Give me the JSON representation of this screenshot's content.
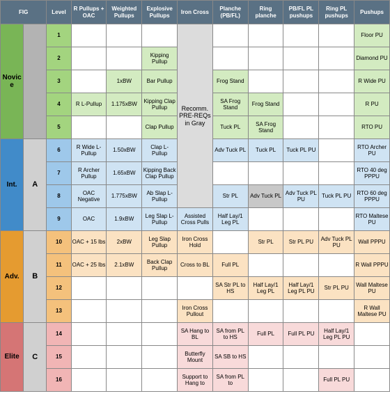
{
  "headers": {
    "fig": "FIG",
    "level": "Level",
    "skills": [
      "R Pullups + OAC",
      "Weighted Pullups",
      "Explosive Pullups",
      "Iron Cross",
      "Planche (PB/FL)",
      "Ring planche",
      "PB/FL PL pushups",
      "Ring PL pushups",
      "Pushups"
    ]
  },
  "tiers": [
    {
      "name": "Novice",
      "fig": "",
      "levels": [
        1,
        2,
        3,
        4,
        5
      ],
      "tierClass": "tier-novice-bg",
      "lvlClass": "lvl-green",
      "figClass": "fig-grey",
      "cellClass": "c-green"
    },
    {
      "name": "Int.",
      "fig": "A",
      "levels": [
        6,
        7,
        8,
        9
      ],
      "tierClass": "tier-int-bg",
      "lvlClass": "lvl-blue",
      "figClass": "fig-ltgrey",
      "cellClass": "c-blue"
    },
    {
      "name": "Adv.",
      "fig": "B",
      "levels": [
        10,
        11,
        12,
        13
      ],
      "tierClass": "tier-adv-bg",
      "lvlClass": "lvl-orange",
      "figClass": "fig-ltgrey",
      "cellClass": "c-orange"
    },
    {
      "name": "Elite",
      "fig": "C",
      "levels": [
        14,
        15,
        16
      ],
      "tierClass": "tier-elite-bg",
      "lvlClass": "lvl-red",
      "figClass": "fig-ltgrey",
      "cellClass": "c-red"
    }
  ],
  "iron_cross_recomm": "Recomm. PRE-REQs in Gray",
  "data": {
    "1": {
      "r_pullups": "",
      "weighted": "",
      "explosive": "",
      "iron_cross": null,
      "planche": "",
      "ring_pl": "",
      "pbfl_pu": "",
      "ringpl_pu": "",
      "pushups": "Floor PU"
    },
    "2": {
      "r_pullups": "",
      "weighted": "",
      "explosive": "Kipping Pullup",
      "iron_cross": null,
      "planche": "",
      "ring_pl": "",
      "pbfl_pu": "",
      "ringpl_pu": "",
      "pushups": "Diamond PU"
    },
    "3": {
      "r_pullups": "",
      "weighted": "1xBW",
      "explosive": "Bar Pullup",
      "iron_cross": null,
      "planche": "Frog Stand",
      "ring_pl": "",
      "pbfl_pu": "",
      "ringpl_pu": "",
      "pushups": "R Wide PU"
    },
    "4": {
      "r_pullups": "R L-Pullup",
      "weighted": "1.175xBW",
      "explosive": "Kipping Clap Pullup",
      "iron_cross": null,
      "planche": "SA Frog Stand",
      "ring_pl": "Frog Stand",
      "pbfl_pu": "",
      "ringpl_pu": "",
      "pushups": "R PU"
    },
    "5": {
      "r_pullups": "",
      "weighted": "",
      "explosive": "Clap Pullup",
      "iron_cross": null,
      "planche": "Tuck PL",
      "ring_pl": "SA Frog Stand",
      "pbfl_pu": "",
      "ringpl_pu": "",
      "pushups": "RTO PU"
    },
    "6": {
      "r_pullups": "R Wide L-Pullup",
      "weighted": "1.50xBW",
      "explosive": "Clap L-Pullup",
      "iron_cross": null,
      "planche": "Adv Tuck PL",
      "ring_pl": "Tuck PL",
      "pbfl_pu": "Tuck PL PU",
      "ringpl_pu": "",
      "pushups": "RTO Archer PU"
    },
    "7": {
      "r_pullups": "R Archer Pullup",
      "weighted": "1.65xBW",
      "explosive": "Kipping Back Clap Pullup",
      "iron_cross": null,
      "planche": "",
      "ring_pl": "",
      "pbfl_pu": "",
      "ringpl_pu": "",
      "pushups": "RTO 40 deg PPPU"
    },
    "8": {
      "r_pullups": "OAC Negative",
      "weighted": "1.775xBW",
      "explosive": "Ab Slap L-Pullup",
      "iron_cross": null,
      "planche": "Str PL",
      "ring_pl": "Adv Tuck PL",
      "pbfl_pu": "Adv Tuck PL PU",
      "ringpl_pu": "Tuck PL PU",
      "pushups": "RTO 60 deg PPPU"
    },
    "9": {
      "r_pullups": "OAC",
      "weighted": "1.9xBW",
      "explosive": "Leg Slap L-Pullup",
      "iron_cross": "Assisted Cross Pulls",
      "planche": "Half Lay/1 Leg PL",
      "ring_pl": "",
      "pbfl_pu": "",
      "ringpl_pu": "",
      "pushups": "RTO Maltese PU"
    },
    "10": {
      "r_pullups": "OAC + 15 lbs",
      "weighted": "2xBW",
      "explosive": "Leg Slap Pullup",
      "iron_cross": "Iron Cross Hold",
      "planche": "",
      "ring_pl": "Str PL",
      "pbfl_pu": "Str PL PU",
      "ringpl_pu": "Adv Tuck PL PU",
      "pushups": "Wall PPPU"
    },
    "11": {
      "r_pullups": "OAC + 25 lbs",
      "weighted": "2.1xBW",
      "explosive": "Back Clap Pullup",
      "iron_cross": "Cross to BL",
      "planche": "Full PL",
      "ring_pl": "",
      "pbfl_pu": "",
      "ringpl_pu": "",
      "pushups": "R Wall PPPU"
    },
    "12": {
      "r_pullups": "",
      "weighted": "",
      "explosive": "",
      "iron_cross": "",
      "planche": "SA Str PL to HS",
      "ring_pl": "Half Lay/1 Leg PL",
      "pbfl_pu": "Half Lay/1 Leg PL PU",
      "ringpl_pu": "Str PL PU",
      "pushups": "Wall Maltese PU"
    },
    "13": {
      "r_pullups": "",
      "weighted": "",
      "explosive": "",
      "iron_cross": "Iron Cross Pullout",
      "planche": "",
      "ring_pl": "",
      "pbfl_pu": "",
      "ringpl_pu": "",
      "pushups": "R Wall Maltese PU"
    },
    "14": {
      "r_pullups": "",
      "weighted": "",
      "explosive": "",
      "iron_cross": "SA Hang to BL",
      "planche": "SA from PL to HS",
      "ring_pl": "Full PL",
      "pbfl_pu": "Full PL PU",
      "ringpl_pu": "Half Lay/1 Leg PL PU",
      "pushups": ""
    },
    "15": {
      "r_pullups": "",
      "weighted": "",
      "explosive": "",
      "iron_cross": "Butterfly Mount",
      "planche": "SA SB to HS",
      "ring_pl": "",
      "pbfl_pu": "",
      "ringpl_pu": "",
      "pushups": ""
    },
    "16": {
      "r_pullups": "",
      "weighted": "",
      "explosive": "",
      "iron_cross": "Support to Hang to",
      "planche": "SA from PL to",
      "ring_pl": "",
      "pbfl_pu": "",
      "ringpl_pu": "Full PL PU",
      "pushups": ""
    }
  },
  "skill_keys": [
    "r_pullups",
    "weighted",
    "explosive",
    "iron_cross",
    "planche",
    "ring_pl",
    "pbfl_pu",
    "ringpl_pu",
    "pushups"
  ]
}
